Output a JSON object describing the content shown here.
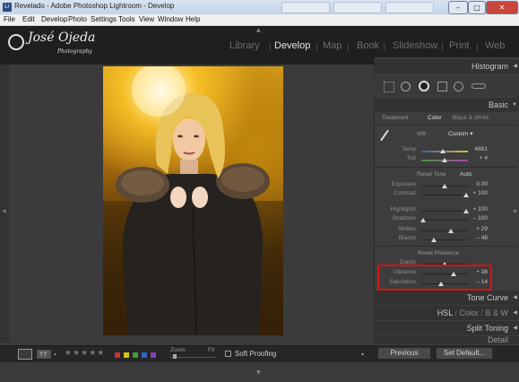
{
  "window": {
    "title": "Revelado - Adobe Photoshop Lightroom - Develop",
    "app_icon": "Lr"
  },
  "menu": [
    "File",
    "Edit",
    "Develop",
    "Photo",
    "Settings",
    "Tools",
    "View",
    "Window",
    "Help"
  ],
  "identity_plate": {
    "name": "José",
    "tagline": "Ojeda",
    "sub": "Photography"
  },
  "modules": [
    "Library",
    "Develop",
    "Map",
    "Book",
    "Slideshow",
    "Print",
    "Web"
  ],
  "active_module": "Develop",
  "panels": {
    "histogram": "Histogram",
    "basic": "Basic",
    "treatment": {
      "label": "Treatment :",
      "color": "Color",
      "bw": "Black & White"
    },
    "wb": {
      "label": "WB :",
      "value": "Custom"
    },
    "temp": {
      "label": "Temp",
      "value": "6881",
      "position": 0.47
    },
    "tint": {
      "label": "Tint",
      "value": "+ 4",
      "position": 0.5
    },
    "tone_header": {
      "label": "Reset Tone",
      "auto": "Auto"
    },
    "exposure": {
      "label": "Exposure",
      "value": "0.00",
      "position": 0.5
    },
    "contrast": {
      "label": "Contrast",
      "value": "+ 100",
      "position": 0.96
    },
    "highlights": {
      "label": "Highlights",
      "value": "+ 100",
      "position": 0.96
    },
    "shadows": {
      "label": "Shadows",
      "value": "– 100",
      "position": 0.04
    },
    "whites": {
      "label": "Whites",
      "value": "+ 29",
      "position": 0.64
    },
    "blacks": {
      "label": "Blacks",
      "value": "– 48",
      "position": 0.26
    },
    "presence_header": "Reset Presence",
    "clarity": {
      "label": "Clarity",
      "value": "",
      "position": 0.5
    },
    "vibrance": {
      "label": "Vibrance",
      "value": "+ 38",
      "position": 0.69
    },
    "saturation": {
      "label": "Saturation",
      "value": "– 14",
      "position": 0.43
    },
    "tone_curve": "Tone Curve",
    "hsl": {
      "hsl": "HSL",
      "color": "Color",
      "bw": "B & W"
    },
    "split_toning": "Split Toning",
    "detail": "Detail"
  },
  "toolbar": {
    "rating_stars": "★★★★★",
    "zoom_label": "Zoom",
    "zoom_value": "Fit",
    "soft_proofing": "Soft Proofing",
    "color_labels": [
      "#c83232",
      "#d4c21f",
      "#3aa23a",
      "#2f63c7",
      "#8a3cc0"
    ]
  },
  "buttons": {
    "previous": "Previous",
    "set_default": "Set Default..."
  },
  "highlight_color": "#dd1111"
}
